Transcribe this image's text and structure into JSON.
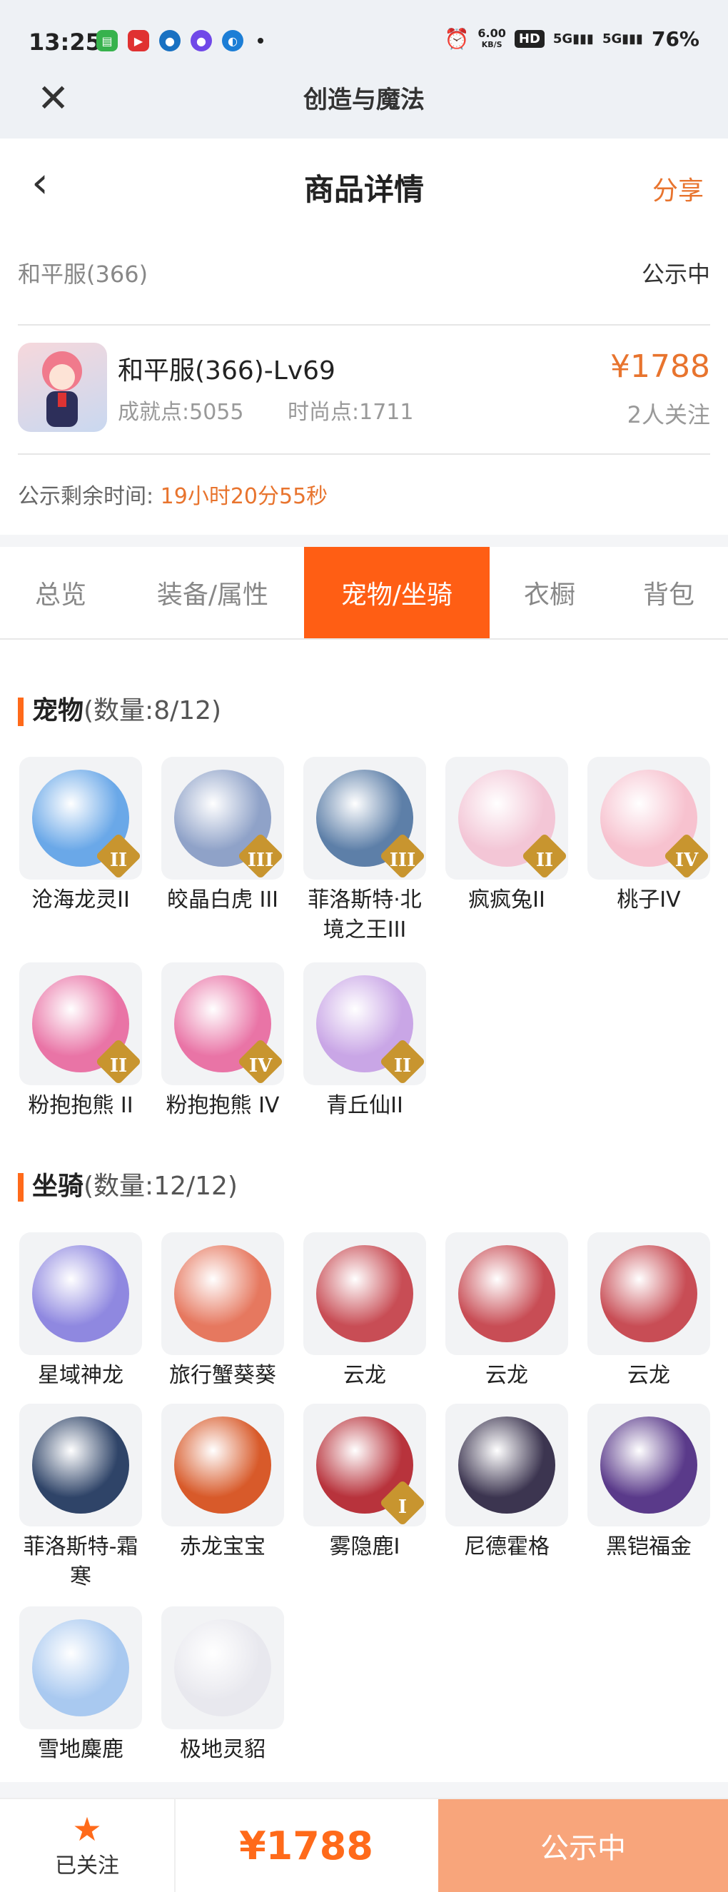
{
  "status_bar": {
    "time": "13:25",
    "net_speed_value": "6.00",
    "net_speed_unit": "KB/S",
    "hd_label": "HD",
    "signal_1": "5G",
    "signal_2": "5G",
    "battery": "76%"
  },
  "app_bar": {
    "title": "创造与魔法"
  },
  "page": {
    "title": "商品详情",
    "share": "分享"
  },
  "server": {
    "name": "和平服(366)",
    "status": "公示中"
  },
  "product": {
    "name": "和平服(366)-Lv69",
    "achievement": "成就点:5055",
    "fashion": "时尚点:1711",
    "price": "¥1788",
    "followers": "2人关注"
  },
  "countdown": {
    "label": "公示剩余时间:",
    "value": "19小时20分55秒"
  },
  "tabs": [
    {
      "label": "总览"
    },
    {
      "label": "装备/属性"
    },
    {
      "label": "宠物/坐骑"
    },
    {
      "label": "衣橱"
    },
    {
      "label": "背包"
    }
  ],
  "pets": {
    "title": "宠物",
    "count": "(数量:8/12)",
    "items": [
      {
        "name": "沧海龙灵II",
        "badge": "II",
        "color": "#6aa8e8"
      },
      {
        "name": "皎晶白虎 III",
        "badge": "III",
        "color": "#8fa2c8"
      },
      {
        "name": "菲洛斯特·北境之王III",
        "badge": "III",
        "color": "#5d7fa8"
      },
      {
        "name": "疯疯兔II",
        "badge": "II",
        "color": "#f3c6d6"
      },
      {
        "name": "桃子IV",
        "badge": "IV",
        "color": "#f7c2cf"
      },
      {
        "name": "粉抱抱熊 II",
        "badge": "II",
        "color": "#e974a6"
      },
      {
        "name": "粉抱抱熊 IV",
        "badge": "IV",
        "color": "#e974a6"
      },
      {
        "name": "青丘仙II",
        "badge": "II",
        "color": "#c9a6e6"
      }
    ]
  },
  "mounts": {
    "title": "坐骑",
    "count": "(数量:12/12)",
    "items": [
      {
        "name": "星域神龙",
        "color": "#8f88e0"
      },
      {
        "name": "旅行蟹葵葵",
        "color": "#e6785f"
      },
      {
        "name": "云龙",
        "color": "#c84d55"
      },
      {
        "name": "云龙",
        "color": "#c84d55"
      },
      {
        "name": "云龙",
        "color": "#c84d55"
      },
      {
        "name": "菲洛斯特-霜寒",
        "color": "#2f4468"
      },
      {
        "name": "赤龙宝宝",
        "color": "#d85a2a"
      },
      {
        "name": "雾隐鹿I",
        "badge": "I",
        "color": "#b8333c"
      },
      {
        "name": "尼德霍格",
        "color": "#3c3550"
      },
      {
        "name": "黑铠福金",
        "color": "#5a3a8a"
      },
      {
        "name": "雪地麋鹿",
        "color": "#a9c9f0"
      },
      {
        "name": "极地灵貂",
        "color": "#e8e8ee"
      }
    ]
  },
  "bottom": {
    "follow": "已关注",
    "price": "¥1788",
    "action": "公示中"
  }
}
